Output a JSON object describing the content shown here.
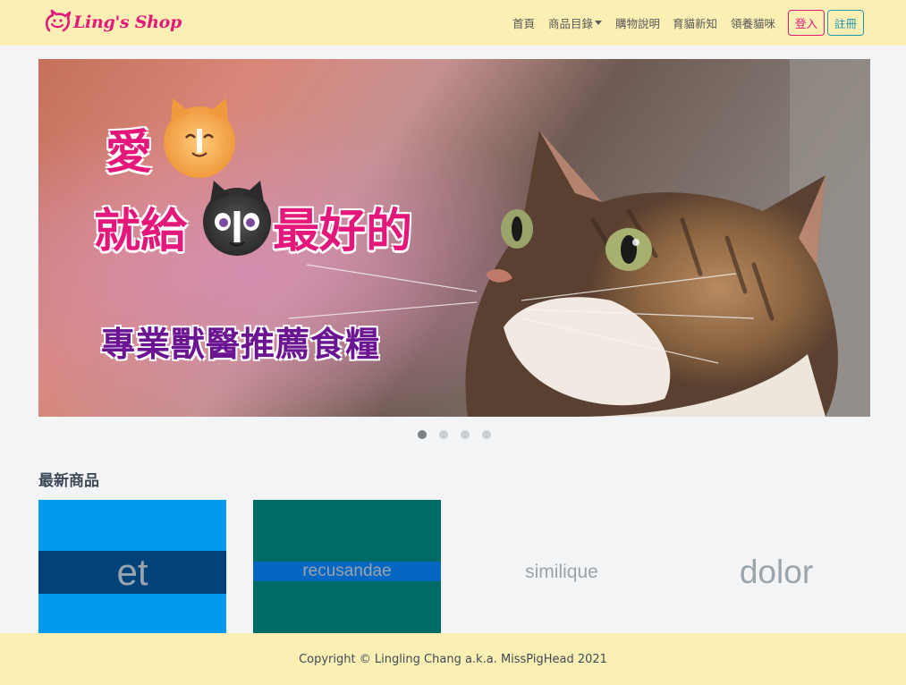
{
  "navbar": {
    "brand": "Ling's Shop",
    "links": [
      "首頁",
      "商品目錄",
      "購物說明",
      "育貓新知",
      "領養貓咪"
    ],
    "login_label": "登入",
    "register_label": "註冊"
  },
  "carousel": {
    "headline_love": "愛",
    "headline_give": "就給",
    "headline_best": "最好的",
    "headline_vet": "專業獸醫推薦食糧",
    "slides_count": 4,
    "active_index": 0
  },
  "latest": {
    "title": "最新商品",
    "products": [
      {
        "label": "et",
        "color": "#0299ee"
      },
      {
        "label": "recusandae",
        "color": "#014379"
      },
      {
        "label": "similique",
        "color": "#006a64"
      },
      {
        "label": "dolor",
        "color": "#0366c0"
      }
    ]
  },
  "footer": {
    "copyright": "Copyright © Lingling Chang a.k.a. MissPigHead 2021"
  },
  "colors": {
    "brand": "#e4177a",
    "nav_bg": "#fcefb4",
    "register": "#1f97b4",
    "headline_purple": "#6b1593"
  }
}
